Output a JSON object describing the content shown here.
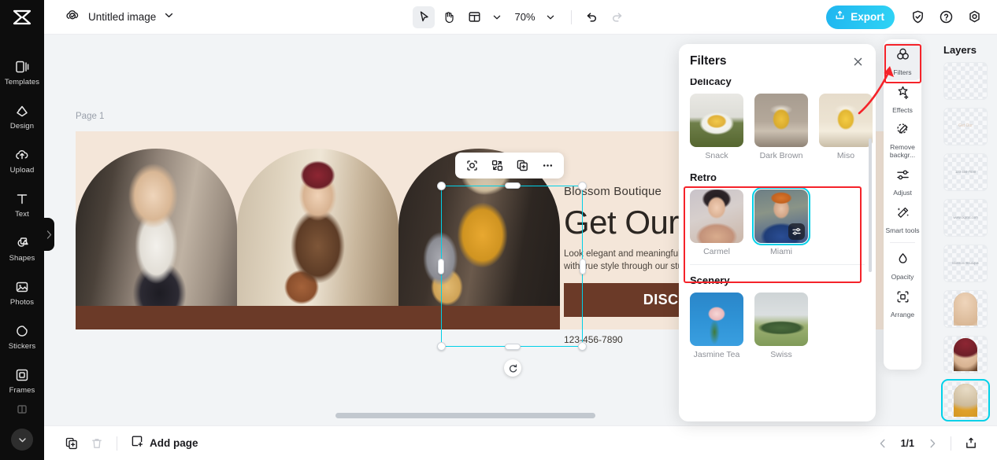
{
  "app": {
    "name": "CapCut"
  },
  "topbar": {
    "doc_title": "Untitled image",
    "cloud_icon": "cloud-check-icon",
    "title_chevron": "chevron-down-icon",
    "tools": [
      {
        "name": "select-tool",
        "icon": "cursor-arrow-icon",
        "active": true
      },
      {
        "name": "hand-tool",
        "icon": "hand-icon",
        "active": false
      },
      {
        "name": "layout-tool",
        "icon": "layout-grid-icon",
        "active": false
      }
    ],
    "zoom_value": "70%",
    "zoom_chevron": "chevron-down-icon",
    "undo_icon": "undo-arrow-icon",
    "redo_icon": "redo-arrow-icon",
    "export_label": "Export",
    "export_icon": "upload-box-icon",
    "export_color": "#2ecdf2",
    "right_icons": [
      {
        "name": "shield-check-icon",
        "label": "Security"
      },
      {
        "name": "help-question-icon",
        "label": "Help"
      },
      {
        "name": "settings-gear-icon",
        "label": "Settings"
      }
    ]
  },
  "left_rail": {
    "logo_icon": "capcut-logo-icon",
    "items": [
      {
        "label": "Templates",
        "icon": "templates-icon"
      },
      {
        "label": "Design",
        "icon": "design-icon"
      },
      {
        "label": "Upload",
        "icon": "upload-cloud-icon"
      },
      {
        "label": "Text",
        "icon": "text-t-icon"
      },
      {
        "label": "Shapes",
        "icon": "shapes-icon"
      },
      {
        "label": "Photos",
        "icon": "photos-image-icon"
      },
      {
        "label": "Stickers",
        "icon": "stickers-icon"
      },
      {
        "label": "Frames",
        "icon": "frames-icon"
      }
    ],
    "more_icon": "chevron-down-icon",
    "collapse_icon": "chevron-right-icon"
  },
  "canvas": {
    "page_label": "Page 1",
    "background": "#f4e6d9",
    "brand_text": "Blossom Boutique",
    "heading_text": "Get Our",
    "body_text": "Look elegant and meaningful wi\nwith true style through our stunn",
    "cta_label": "DISCOUNT UP",
    "cta_color": "#6b3a28",
    "phone": "123-456-7890",
    "website": "www.c",
    "photos": [
      {
        "name": "model-photo-1",
        "alt": "woman in white sweater with white bag"
      },
      {
        "name": "model-photo-2",
        "alt": "woman in leopard blouse with brown bag"
      },
      {
        "name": "model-photo-3",
        "alt": "woman in yellow top with tan bag",
        "selected": true
      }
    ],
    "float_toolbar": [
      {
        "name": "cutout-icon",
        "label": "Cutout"
      },
      {
        "name": "replace-icon",
        "label": "Replace"
      },
      {
        "name": "duplicate-icon",
        "label": "Duplicate"
      },
      {
        "name": "more-options-icon",
        "label": "More"
      }
    ],
    "rotate_icon": "rotate-icon",
    "selection_color": "#00d0e8"
  },
  "filters_panel": {
    "title": "Filters",
    "close_icon": "close-x-icon",
    "sections": [
      {
        "title": "Delicacy",
        "items": [
          {
            "name": "Snack",
            "thumb": "t-snack",
            "selected": false
          },
          {
            "name": "Dark Brown",
            "thumb": "t-darkbrown",
            "selected": false
          },
          {
            "name": "Miso",
            "thumb": "t-miso",
            "selected": false
          }
        ]
      },
      {
        "title": "Retro",
        "highlighted": true,
        "items": [
          {
            "name": "Carmel",
            "thumb": "t-carmel",
            "selected": false
          },
          {
            "name": "Miami",
            "thumb": "t-miami",
            "selected": true,
            "badge_icon": "adjust-sliders-icon"
          }
        ]
      },
      {
        "title": "Scenery",
        "items": [
          {
            "name": "Jasmine Tea",
            "thumb": "t-jasmine",
            "selected": false
          },
          {
            "name": "Swiss",
            "thumb": "t-swiss",
            "selected": false
          }
        ]
      }
    ]
  },
  "right_rail": {
    "items": [
      {
        "label": "Filters",
        "icon": "filters-circles-icon",
        "active": true,
        "highlighted": true
      },
      {
        "label": "Effects",
        "icon": "effects-sparkle-icon",
        "active": false
      },
      {
        "label": "Remove backgr...",
        "icon": "remove-background-icon",
        "active": false
      },
      {
        "label": "Adjust",
        "icon": "adjust-sliders-icon",
        "active": false
      },
      {
        "label": "Smart tools",
        "icon": "smart-tools-wand-icon",
        "active": false
      },
      {
        "label": "Opacity",
        "icon": "opacity-drop-icon",
        "active": false,
        "after_divider": true
      },
      {
        "label": "Arrange",
        "icon": "arrange-icon",
        "active": false
      }
    ]
  },
  "layers_panel": {
    "title": "Layers",
    "items": [
      {
        "name": "layer-text-1",
        "type": "text",
        "caption": "",
        "faint": true
      },
      {
        "name": "layer-text-2",
        "type": "text",
        "caption": "Get Our",
        "faint": true
      },
      {
        "name": "layer-phone",
        "type": "text",
        "caption": "123-456-7890"
      },
      {
        "name": "layer-website",
        "type": "text",
        "caption": "www.ckpcut.com"
      },
      {
        "name": "layer-brand",
        "type": "text",
        "caption": "Blossom Boutique"
      },
      {
        "name": "layer-photo-1",
        "type": "image"
      },
      {
        "name": "layer-photo-2",
        "type": "image"
      },
      {
        "name": "layer-photo-3",
        "type": "image",
        "selected": true
      }
    ]
  },
  "bottombar": {
    "duplicate_icon": "duplicate-icon",
    "delete_icon": "trash-icon",
    "add_page_icon": "add-page-icon",
    "add_page_label": "Add page",
    "prev_icon": "chevron-left-icon",
    "next_icon": "chevron-right-icon",
    "page_indicator": "1/1",
    "export_icon": "export-tray-icon"
  },
  "annotations": {
    "highlight_color": "#f5232a",
    "arrow": "red-arrow-pointing-to-filters-button"
  }
}
